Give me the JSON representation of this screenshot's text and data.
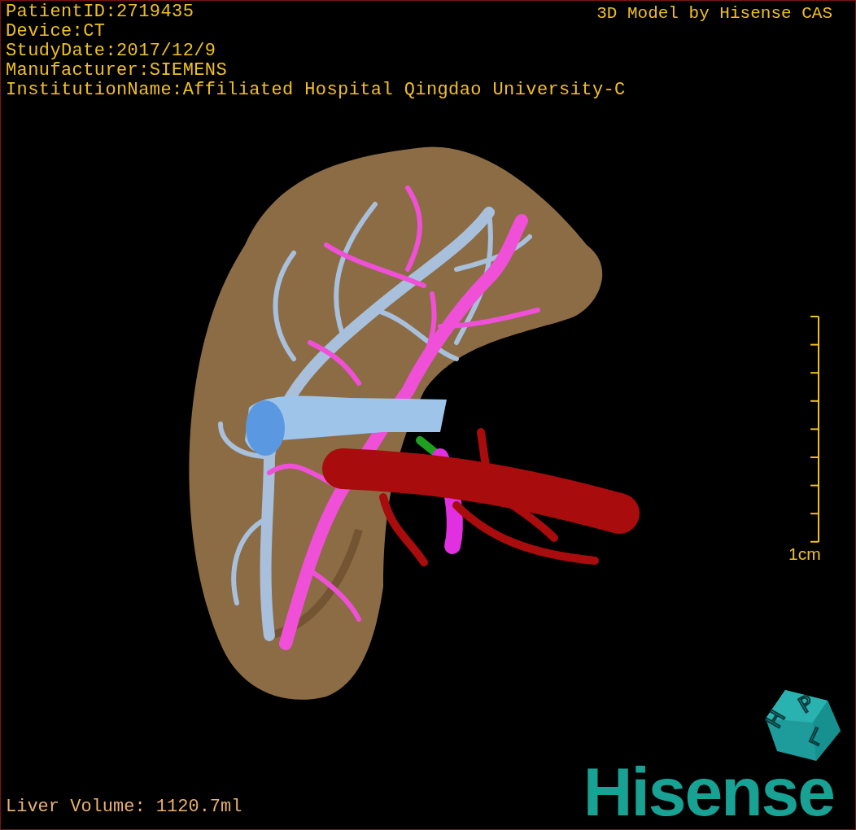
{
  "info_lines": [
    "PatientID:2719435",
    "Device:CT",
    "StudyDate:2017/12/9",
    "Manufacturer:SIEMENS",
    "InstitutionName:Affiliated Hospital Qingdao University-C"
  ],
  "model_credit": "3D Model by Hisense CAS",
  "scale_bar": {
    "label": "1cm"
  },
  "liver_volume": "Liver Volume: 1120.7ml",
  "orientation_cube": {
    "labels": [
      "H",
      "P",
      "L"
    ]
  },
  "logo": "Hisense"
}
